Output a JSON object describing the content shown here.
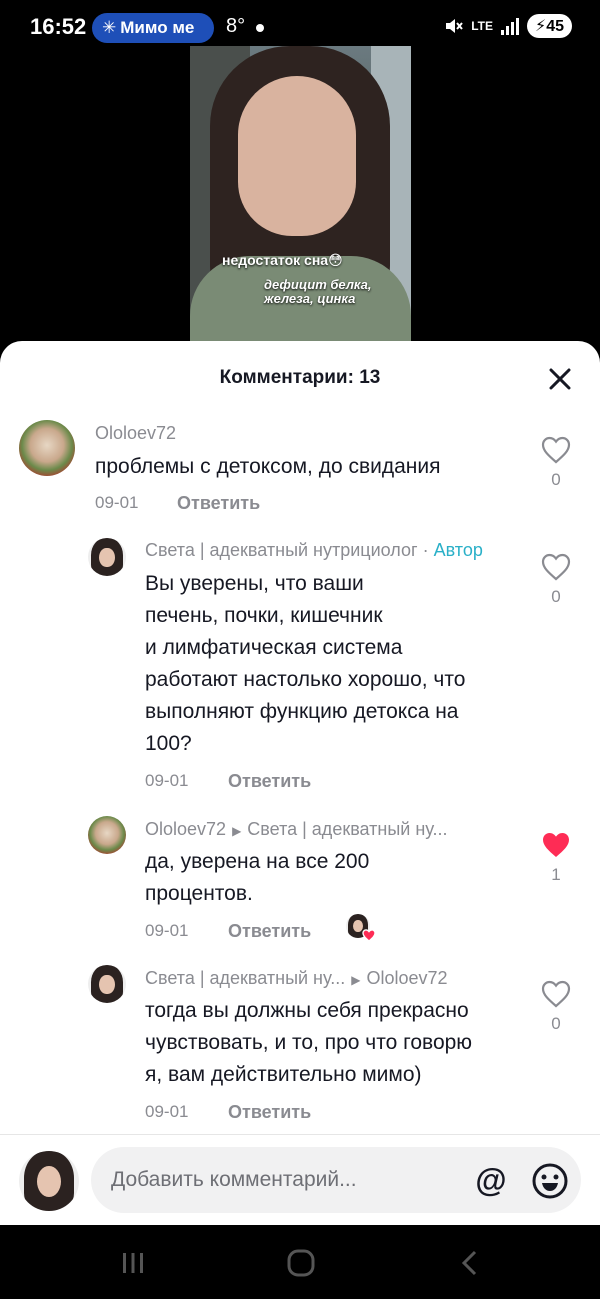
{
  "status_bar": {
    "time": "16:52",
    "pill_icon": "✳",
    "pill_text": "Мимо ме",
    "temperature": "8°",
    "network": "LTE",
    "battery": "45"
  },
  "video": {
    "caption_1": "недостаток сна😳",
    "caption_2": "дефицит белка,",
    "caption_3": "железа, цинка"
  },
  "comments_sheet": {
    "title": "Комментарии: 13",
    "close_icon": "close-icon",
    "comments": [
      {
        "author": "Ololoev72",
        "text": "проблемы с детоксом, до свидания",
        "date": "09-01",
        "reply_label": "Ответить",
        "likes": "0"
      }
    ],
    "replies": [
      {
        "author": "Света | адекватный нутрициолог",
        "separator": "·",
        "author_badge": "Автор",
        "text_lines": [
          "Вы уверены, что ваши",
          "печень, почки, кишечник",
          "и лимфатическая система",
          "работают настолько хорошо, что",
          "выполняют функцию детокса на",
          "100?"
        ],
        "date": "09-01",
        "reply_label": "Ответить",
        "likes": "0"
      },
      {
        "author": "Ololoev72",
        "reply_to": "Света | адекватный ну...",
        "text_lines": [
          "да, уверена на все 200",
          "процентов."
        ],
        "date": "09-01",
        "reply_label": "Ответить",
        "likes": "1",
        "liked": true
      },
      {
        "author": "Света | адекватный ну...",
        "reply_to": "Ololoev72",
        "text_lines": [
          "тогда вы должны себя прекрасно",
          "чувствовать, и то, про что говорю",
          "я, вам действительно мимо)"
        ],
        "date": "09-01",
        "reply_label": "Ответить",
        "likes": "0"
      }
    ],
    "input": {
      "placeholder": "Добавить комментарий...",
      "mention_label": "@"
    }
  },
  "colors": {
    "accent_author": "#2ab0c8",
    "like_active": "#fe2c55",
    "pill": "#1e4fb8"
  }
}
